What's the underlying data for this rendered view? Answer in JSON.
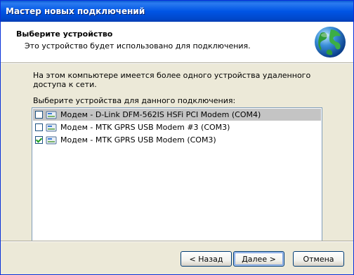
{
  "window": {
    "title": "Мастер новых подключений"
  },
  "header": {
    "title": "Выберите устройство",
    "subtitle": "Это устройство будет использовано для подключения.",
    "icon": "globe-icon"
  },
  "body": {
    "description": "На этом компьютере имеется более одного устройства удаленного доступа к сети.",
    "list_label": "Выберите устройства для данного подключения:",
    "devices": [
      {
        "label": "Модем - D-Link DFM-562IS HSFi PCI Modem (COM4)",
        "checked": false,
        "selected": true
      },
      {
        "label": "Модем - MTK GPRS USB Modem #3 (COM3)",
        "checked": false,
        "selected": false
      },
      {
        "label": "Модем - MTK GPRS USB Modem (COM3)",
        "checked": true,
        "selected": false
      }
    ]
  },
  "buttons": {
    "back": "< Назад",
    "next": "Далее >",
    "cancel": "Отмена"
  },
  "colors": {
    "titlebar": "#0055e5",
    "selection": "#c4c4c4",
    "face": "#ece9d8"
  }
}
